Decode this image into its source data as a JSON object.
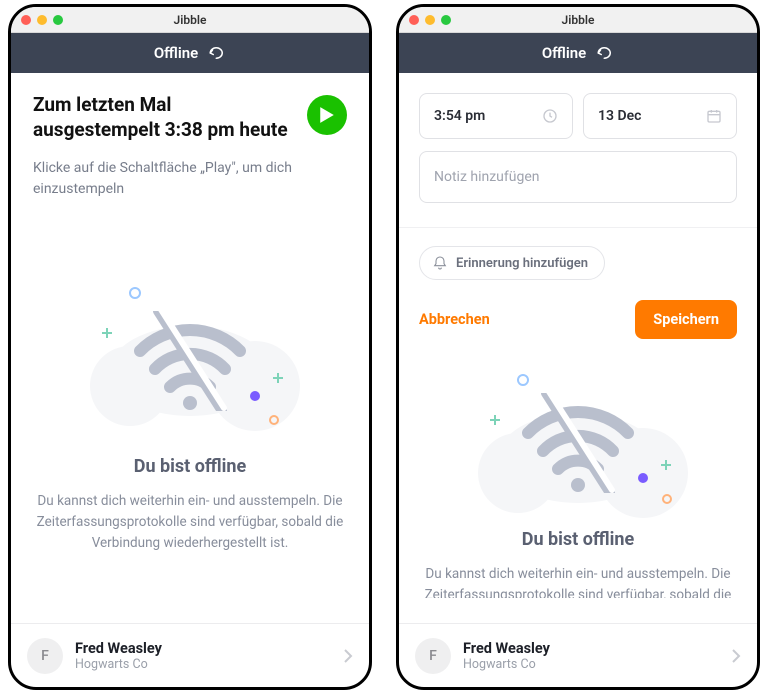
{
  "left": {
    "appTitle": "Jibble",
    "topbarStatus": "Offline",
    "heading": "Zum letzten Mal ausgestempelt 3:38 pm heute",
    "subtext": "Klicke auf die Schaltfläche „Play\", um dich einzustempeln",
    "offlineTitle": "Du bist offline",
    "offlineDesc": "Du kannst dich weiterhin ein- und ausstempeln. Die Zeiterfassungsprotokolle sind verfügbar, sobald die Verbindung wiederhergestellt ist.",
    "user": {
      "initial": "F",
      "name": "Fred Weasley",
      "org": "Hogwarts Co"
    }
  },
  "right": {
    "appTitle": "Jibble",
    "topbarStatus": "Offline",
    "time": "3:54 pm",
    "date": "13 Dec",
    "notePlaceholder": "Notiz hinzufügen",
    "reminderLabel": "Erinnerung hinzufügen",
    "cancelLabel": "Abbrechen",
    "saveLabel": "Speichern",
    "offlineTitle": "Du bist offline",
    "offlineDesc": "Du kannst dich weiterhin ein- und ausstempeln. Die Zeiterfassungsprotokolle sind verfügbar, sobald die Verbindung wiederhergestellt ist.",
    "user": {
      "initial": "F",
      "name": "Fred Weasley",
      "org": "Hogwarts Co"
    }
  }
}
